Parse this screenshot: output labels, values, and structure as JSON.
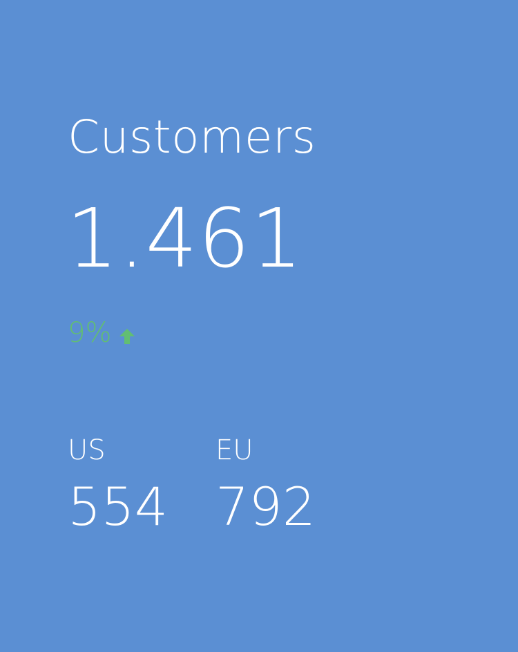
{
  "widget": {
    "title": "Customers",
    "total": "1.461",
    "change": {
      "value": "9%",
      "direction_icon": "arrow-up-icon",
      "color": "#62be72"
    },
    "regions": [
      {
        "label": "US",
        "value": "554"
      },
      {
        "label": "EU",
        "value": "792"
      }
    ]
  },
  "colors": {
    "background": "#5b8fd3",
    "text": "#ffffff",
    "positive": "#62be72"
  }
}
